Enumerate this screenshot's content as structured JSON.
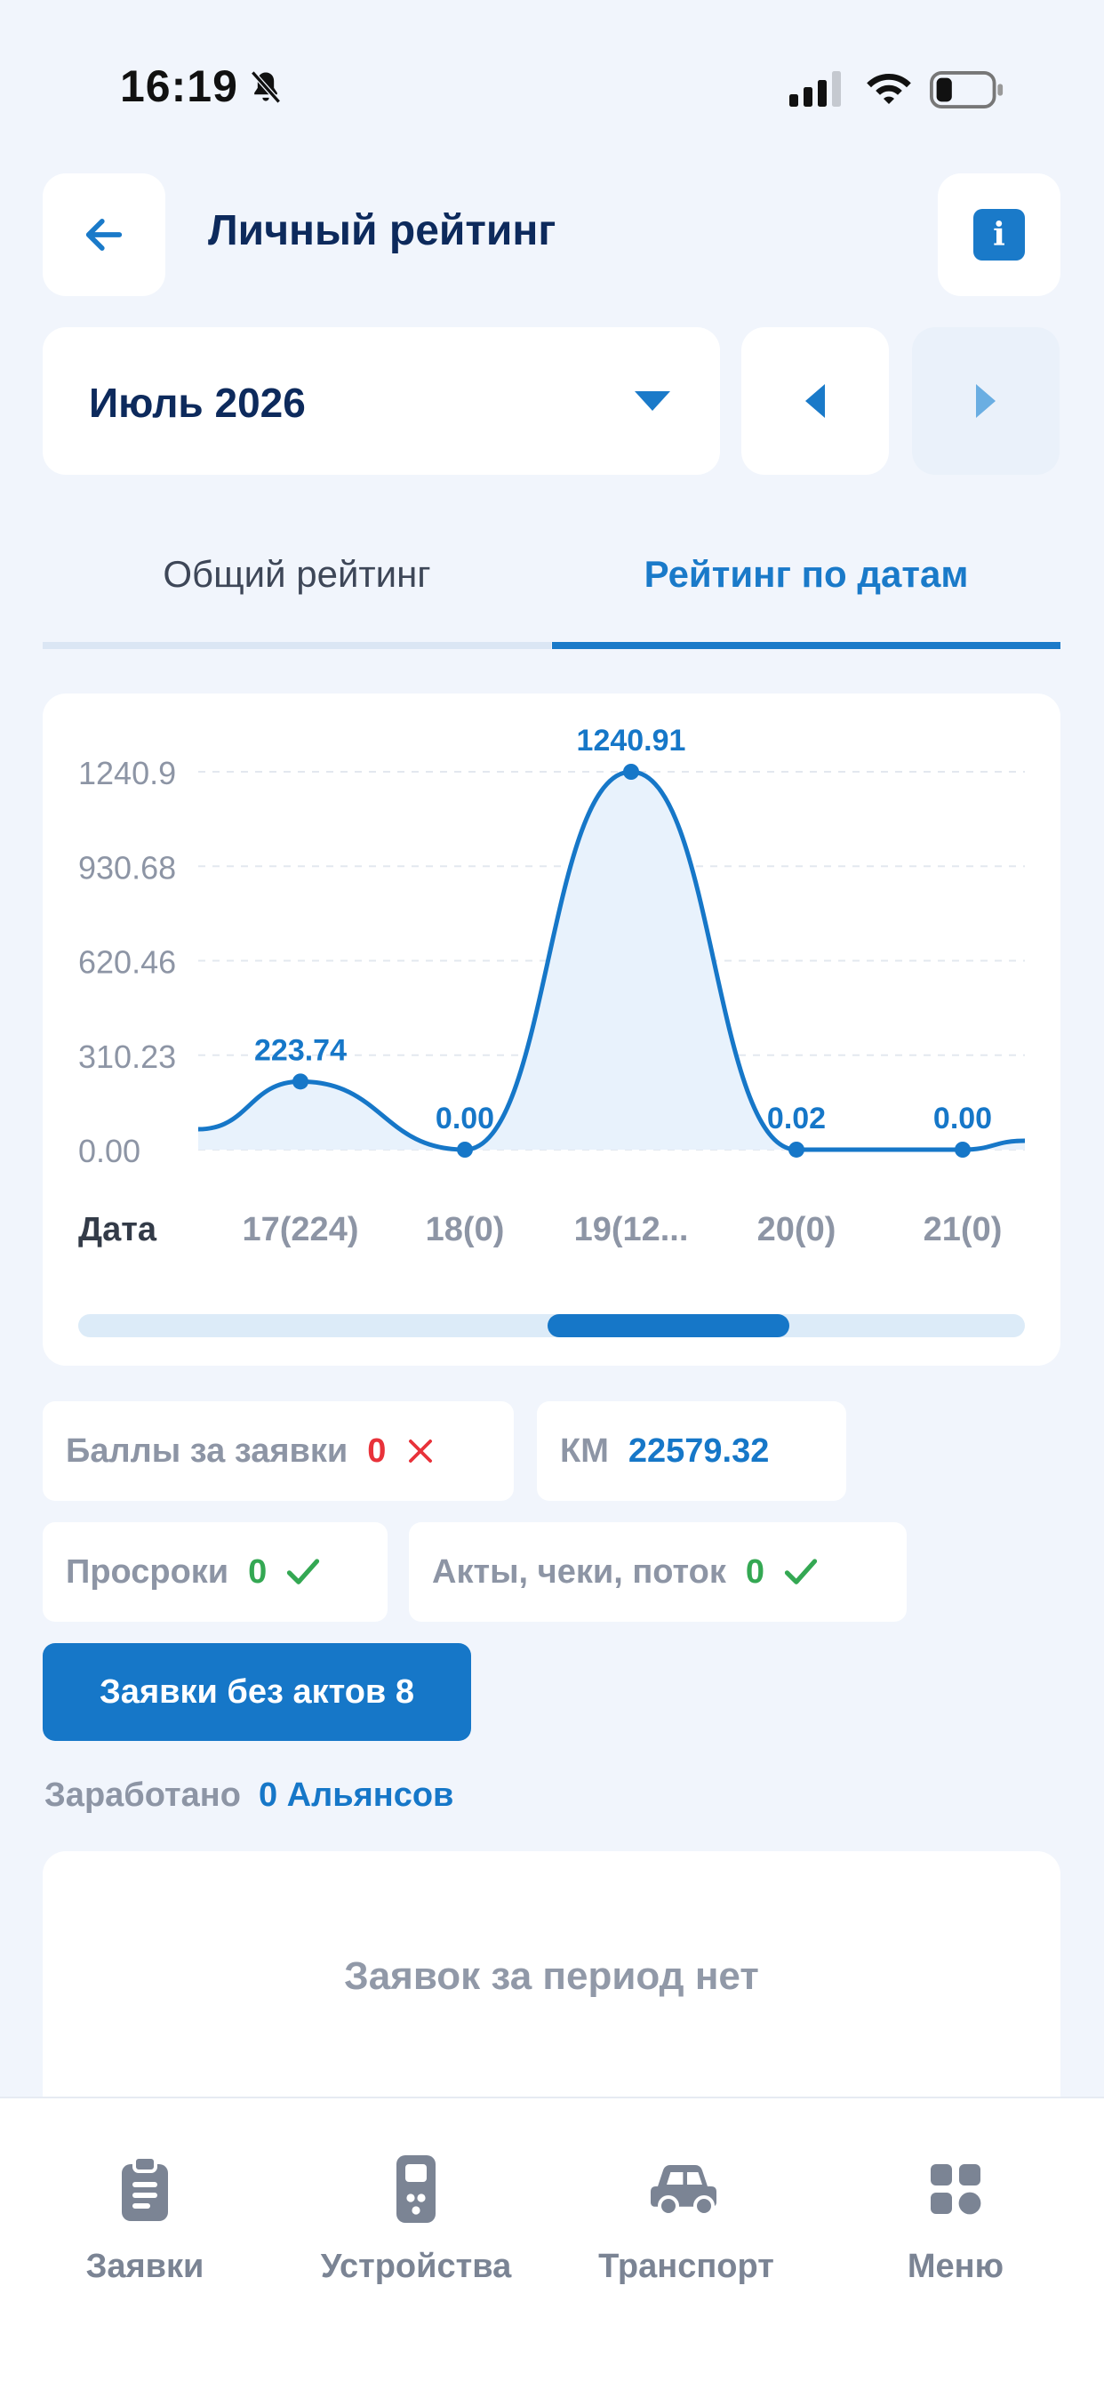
{
  "status_bar": {
    "time": "16:19"
  },
  "header": {
    "title": "Личный рейтинг"
  },
  "period": {
    "month_label": "Июль 2026"
  },
  "tabs": [
    {
      "label": "Общий рейтинг",
      "active": false
    },
    {
      "label": "Рейтинг по датам",
      "active": true
    }
  ],
  "chart_data": {
    "type": "area",
    "xlabel": "Дата",
    "categories": [
      "17(224)",
      "18(0)",
      "19(12...",
      "20(0)",
      "21(0)"
    ],
    "values": [
      223.74,
      0.0,
      1240.91,
      0.02,
      0.0
    ],
    "value_labels": [
      "223.74",
      "0.00",
      "1240.91",
      "0.02",
      "0.00"
    ],
    "yticks": [
      "1240.9",
      "930.68",
      "620.46",
      "310.23",
      "0.00"
    ],
    "ylim": [
      0,
      1240.91
    ],
    "grid": true,
    "colors": {
      "line": "#1677c8",
      "fill": "#e8f2fc"
    }
  },
  "stats": {
    "scores_label": "Баллы за заявки",
    "scores_value": "0",
    "km_label": "КМ",
    "km_value": "22579.32",
    "overdue_label": "Просроки",
    "overdue_value": "0",
    "acts_label": "Акты, чеки, поток",
    "acts_value": "0"
  },
  "requests_button": "Заявки без актов 8",
  "earned": {
    "label": "Заработано",
    "value": "0 Альянсов"
  },
  "empty_state": "Заявок за период нет",
  "bottom_nav": [
    {
      "label": "Заявки",
      "icon": "clipboard-icon"
    },
    {
      "label": "Устройства",
      "icon": "device-icon"
    },
    {
      "label": "Транспорт",
      "icon": "car-icon"
    },
    {
      "label": "Меню",
      "icon": "grid-menu-icon"
    }
  ],
  "colors": {
    "accent": "#1677c8",
    "title": "#0d2a5c",
    "error": "#e8323a",
    "success": "#34a853"
  }
}
